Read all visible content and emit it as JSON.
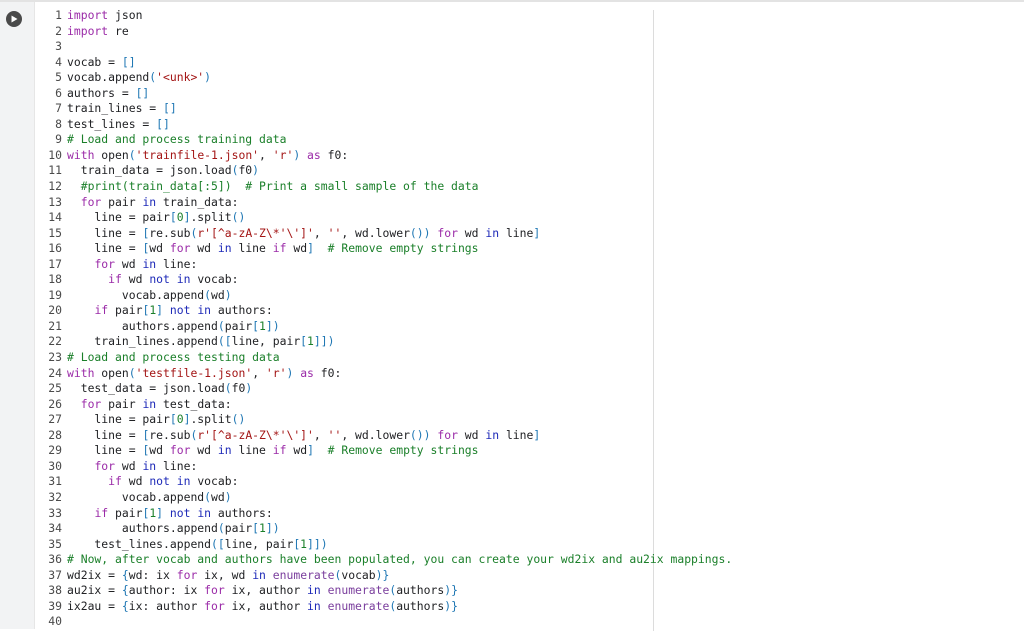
{
  "toolbar": {
    "run_icon": "play-icon"
  },
  "colors": {
    "keyword": "#1e2ab8",
    "import_keyword": "#9b2ba8",
    "string": "#a31515",
    "comment": "#1a7f29",
    "builtin": "#7a3e9d",
    "bracket": "#1f77b4",
    "gutter_bg": "#f2f3f4"
  },
  "code_lines": [
    [
      {
        "t": "import",
        "c": "kw2"
      },
      {
        "t": " json"
      }
    ],
    [
      {
        "t": "import",
        "c": "kw2"
      },
      {
        "t": " re"
      }
    ],
    [],
    [
      {
        "t": "vocab = "
      },
      {
        "t": "[]",
        "c": "br"
      }
    ],
    [
      {
        "t": "vocab.append"
      },
      {
        "t": "(",
        "c": "br"
      },
      {
        "t": "'<unk>'",
        "c": "str"
      },
      {
        "t": ")",
        "c": "br"
      }
    ],
    [
      {
        "t": "authors = "
      },
      {
        "t": "[]",
        "c": "br"
      }
    ],
    [
      {
        "t": "train_lines = "
      },
      {
        "t": "[]",
        "c": "br"
      }
    ],
    [
      {
        "t": "test_lines = "
      },
      {
        "t": "[]",
        "c": "br"
      }
    ],
    [
      {
        "t": "# Load and process training data",
        "c": "com"
      }
    ],
    [
      {
        "t": "with",
        "c": "kw2"
      },
      {
        "t": " open"
      },
      {
        "t": "(",
        "c": "br"
      },
      {
        "t": "'trainfile-1.json'",
        "c": "str"
      },
      {
        "t": ", "
      },
      {
        "t": "'r'",
        "c": "str"
      },
      {
        "t": ")",
        "c": "br"
      },
      {
        "t": " as",
        "c": "kw2"
      },
      {
        "t": " f0:"
      }
    ],
    [
      {
        "t": "  train_data = json.load"
      },
      {
        "t": "(",
        "c": "br"
      },
      {
        "t": "f0"
      },
      {
        "t": ")",
        "c": "br"
      }
    ],
    [
      {
        "t": "  "
      },
      {
        "t": "#print(train_data[:5])  # Print a small sample of the data",
        "c": "com"
      }
    ],
    [
      {
        "t": "  "
      },
      {
        "t": "for",
        "c": "kw2"
      },
      {
        "t": " pair "
      },
      {
        "t": "in",
        "c": "kw"
      },
      {
        "t": " train_data:"
      }
    ],
    [
      {
        "t": "    line = pair"
      },
      {
        "t": "[",
        "c": "br"
      },
      {
        "t": "0",
        "c": "num"
      },
      {
        "t": "]",
        "c": "br"
      },
      {
        "t": ".split"
      },
      {
        "t": "()",
        "c": "br"
      }
    ],
    [
      {
        "t": "    line = "
      },
      {
        "t": "[",
        "c": "br"
      },
      {
        "t": "re.sub"
      },
      {
        "t": "(",
        "c": "br"
      },
      {
        "t": "r'[^a-zA-Z\\*'\\']'",
        "c": "str"
      },
      {
        "t": ", "
      },
      {
        "t": "''",
        "c": "str"
      },
      {
        "t": ", wd.lower"
      },
      {
        "t": "())",
        "c": "br"
      },
      {
        "t": " for",
        "c": "kw2"
      },
      {
        "t": " wd "
      },
      {
        "t": "in",
        "c": "kw"
      },
      {
        "t": " line"
      },
      {
        "t": "]",
        "c": "br"
      }
    ],
    [
      {
        "t": "    line = "
      },
      {
        "t": "[",
        "c": "br"
      },
      {
        "t": "wd "
      },
      {
        "t": "for",
        "c": "kw2"
      },
      {
        "t": " wd "
      },
      {
        "t": "in",
        "c": "kw"
      },
      {
        "t": " line "
      },
      {
        "t": "if",
        "c": "kw2"
      },
      {
        "t": " wd"
      },
      {
        "t": "]",
        "c": "br"
      },
      {
        "t": "  "
      },
      {
        "t": "# Remove empty strings",
        "c": "com"
      }
    ],
    [
      {
        "t": "    "
      },
      {
        "t": "for",
        "c": "kw2"
      },
      {
        "t": " wd "
      },
      {
        "t": "in",
        "c": "kw"
      },
      {
        "t": " line:"
      }
    ],
    [
      {
        "t": "      "
      },
      {
        "t": "if",
        "c": "kw2"
      },
      {
        "t": " wd "
      },
      {
        "t": "not in",
        "c": "kw"
      },
      {
        "t": " vocab:"
      }
    ],
    [
      {
        "t": "        vocab.append"
      },
      {
        "t": "(",
        "c": "br"
      },
      {
        "t": "wd"
      },
      {
        "t": ")",
        "c": "br"
      }
    ],
    [
      {
        "t": "    "
      },
      {
        "t": "if",
        "c": "kw2"
      },
      {
        "t": " pair"
      },
      {
        "t": "[",
        "c": "br"
      },
      {
        "t": "1",
        "c": "num"
      },
      {
        "t": "]",
        "c": "br"
      },
      {
        "t": " not in",
        "c": "kw"
      },
      {
        "t": " authors:"
      }
    ],
    [
      {
        "t": "        authors.append"
      },
      {
        "t": "(",
        "c": "br"
      },
      {
        "t": "pair"
      },
      {
        "t": "[",
        "c": "br"
      },
      {
        "t": "1",
        "c": "num"
      },
      {
        "t": "])",
        "c": "br"
      }
    ],
    [
      {
        "t": "    train_lines.append"
      },
      {
        "t": "([",
        "c": "br"
      },
      {
        "t": "line, pair"
      },
      {
        "t": "[",
        "c": "br"
      },
      {
        "t": "1",
        "c": "num"
      },
      {
        "t": "]])",
        "c": "br"
      }
    ],
    [
      {
        "t": "# Load and process testing data",
        "c": "com"
      }
    ],
    [
      {
        "t": "with",
        "c": "kw2"
      },
      {
        "t": " open"
      },
      {
        "t": "(",
        "c": "br"
      },
      {
        "t": "'testfile-1.json'",
        "c": "str"
      },
      {
        "t": ", "
      },
      {
        "t": "'r'",
        "c": "str"
      },
      {
        "t": ")",
        "c": "br"
      },
      {
        "t": " as",
        "c": "kw2"
      },
      {
        "t": " f0:"
      }
    ],
    [
      {
        "t": "  test_data = json.load"
      },
      {
        "t": "(",
        "c": "br"
      },
      {
        "t": "f0"
      },
      {
        "t": ")",
        "c": "br"
      }
    ],
    [
      {
        "t": "  "
      },
      {
        "t": "for",
        "c": "kw2"
      },
      {
        "t": " pair "
      },
      {
        "t": "in",
        "c": "kw"
      },
      {
        "t": " test_data:"
      }
    ],
    [
      {
        "t": "    line = pair"
      },
      {
        "t": "[",
        "c": "br"
      },
      {
        "t": "0",
        "c": "num"
      },
      {
        "t": "]",
        "c": "br"
      },
      {
        "t": ".split"
      },
      {
        "t": "()",
        "c": "br"
      }
    ],
    [
      {
        "t": "    line = "
      },
      {
        "t": "[",
        "c": "br"
      },
      {
        "t": "re.sub"
      },
      {
        "t": "(",
        "c": "br"
      },
      {
        "t": "r'[^a-zA-Z\\*'\\']'",
        "c": "str"
      },
      {
        "t": ", "
      },
      {
        "t": "''",
        "c": "str"
      },
      {
        "t": ", wd.lower"
      },
      {
        "t": "())",
        "c": "br"
      },
      {
        "t": " for",
        "c": "kw2"
      },
      {
        "t": " wd "
      },
      {
        "t": "in",
        "c": "kw"
      },
      {
        "t": " line"
      },
      {
        "t": "]",
        "c": "br"
      }
    ],
    [
      {
        "t": "    line = "
      },
      {
        "t": "[",
        "c": "br"
      },
      {
        "t": "wd "
      },
      {
        "t": "for",
        "c": "kw2"
      },
      {
        "t": " wd "
      },
      {
        "t": "in",
        "c": "kw"
      },
      {
        "t": " line "
      },
      {
        "t": "if",
        "c": "kw2"
      },
      {
        "t": " wd"
      },
      {
        "t": "]",
        "c": "br"
      },
      {
        "t": "  "
      },
      {
        "t": "# Remove empty strings",
        "c": "com"
      }
    ],
    [
      {
        "t": "    "
      },
      {
        "t": "for",
        "c": "kw2"
      },
      {
        "t": " wd "
      },
      {
        "t": "in",
        "c": "kw"
      },
      {
        "t": " line:"
      }
    ],
    [
      {
        "t": "      "
      },
      {
        "t": "if",
        "c": "kw2"
      },
      {
        "t": " wd "
      },
      {
        "t": "not in",
        "c": "kw"
      },
      {
        "t": " vocab:"
      }
    ],
    [
      {
        "t": "        vocab.append"
      },
      {
        "t": "(",
        "c": "br"
      },
      {
        "t": "wd"
      },
      {
        "t": ")",
        "c": "br"
      }
    ],
    [
      {
        "t": "    "
      },
      {
        "t": "if",
        "c": "kw2"
      },
      {
        "t": " pair"
      },
      {
        "t": "[",
        "c": "br"
      },
      {
        "t": "1",
        "c": "num"
      },
      {
        "t": "]",
        "c": "br"
      },
      {
        "t": " not in",
        "c": "kw"
      },
      {
        "t": " authors:"
      }
    ],
    [
      {
        "t": "        authors.append"
      },
      {
        "t": "(",
        "c": "br"
      },
      {
        "t": "pair"
      },
      {
        "t": "[",
        "c": "br"
      },
      {
        "t": "1",
        "c": "num"
      },
      {
        "t": "])",
        "c": "br"
      }
    ],
    [
      {
        "t": "    test_lines.append"
      },
      {
        "t": "([",
        "c": "br"
      },
      {
        "t": "line, pair"
      },
      {
        "t": "[",
        "c": "br"
      },
      {
        "t": "1",
        "c": "num"
      },
      {
        "t": "]])",
        "c": "br"
      }
    ],
    [
      {
        "t": "# Now, after vocab and authors have been populated, you can create your wd2ix and au2ix mappings.",
        "c": "com"
      }
    ],
    [
      {
        "t": "wd2ix = "
      },
      {
        "t": "{",
        "c": "br"
      },
      {
        "t": "wd: ix "
      },
      {
        "t": "for",
        "c": "kw2"
      },
      {
        "t": " ix, wd "
      },
      {
        "t": "in",
        "c": "kw"
      },
      {
        "t": " enumerate",
        "c": "fn"
      },
      {
        "t": "(",
        "c": "br"
      },
      {
        "t": "vocab"
      },
      {
        "t": ")}",
        "c": "br"
      }
    ],
    [
      {
        "t": "au2ix = "
      },
      {
        "t": "{",
        "c": "br"
      },
      {
        "t": "author: ix "
      },
      {
        "t": "for",
        "c": "kw2"
      },
      {
        "t": " ix, author "
      },
      {
        "t": "in",
        "c": "kw"
      },
      {
        "t": " enumerate",
        "c": "fn"
      },
      {
        "t": "(",
        "c": "br"
      },
      {
        "t": "authors"
      },
      {
        "t": ")}",
        "c": "br"
      }
    ],
    [
      {
        "t": "ix2au = "
      },
      {
        "t": "{",
        "c": "br"
      },
      {
        "t": "ix: author "
      },
      {
        "t": "for",
        "c": "kw2"
      },
      {
        "t": " ix, author "
      },
      {
        "t": "in",
        "c": "kw"
      },
      {
        "t": " enumerate",
        "c": "fn"
      },
      {
        "t": "(",
        "c": "br"
      },
      {
        "t": "authors"
      },
      {
        "t": ")}",
        "c": "br"
      }
    ],
    []
  ]
}
